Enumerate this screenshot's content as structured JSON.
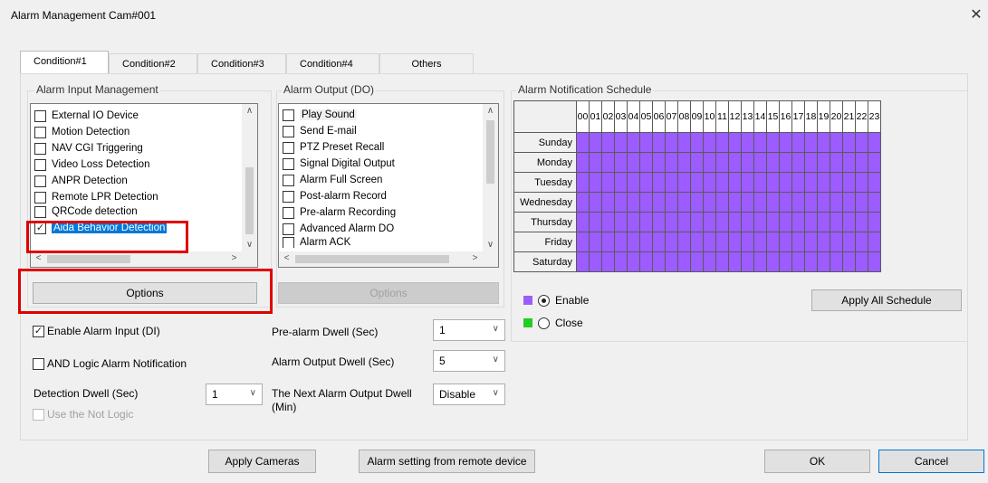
{
  "window": {
    "title": "Alarm Management Cam#001",
    "close_glyph": "✕"
  },
  "tabs": [
    "Condition#1",
    "Condition#2",
    "Condition#3",
    "Condition#4",
    "Others"
  ],
  "input_group": {
    "label": "Alarm Input Management",
    "items": [
      {
        "label": "External IO Device",
        "checked": false
      },
      {
        "label": "Motion Detection",
        "checked": false
      },
      {
        "label": "NAV CGI Triggering",
        "checked": false
      },
      {
        "label": "Video Loss Detection",
        "checked": false
      },
      {
        "label": "ANPR Detection",
        "checked": false
      },
      {
        "label": "Remote LPR Detection",
        "checked": false
      },
      {
        "label": "QRCode detection",
        "checked": false
      },
      {
        "label": "Aida Behavior Detection",
        "checked": true
      }
    ],
    "options_label": "Options"
  },
  "output_group": {
    "label": "Alarm Output (DO)",
    "items": [
      {
        "label": "Play Sound",
        "checked": false
      },
      {
        "label": "Send E-mail",
        "checked": false
      },
      {
        "label": "PTZ Preset Recall",
        "checked": false
      },
      {
        "label": "Signal Digital Output",
        "checked": false
      },
      {
        "label": "Alarm Full Screen",
        "checked": false
      },
      {
        "label": "Post-alarm Record",
        "checked": false
      },
      {
        "label": "Pre-alarm Recording",
        "checked": false
      },
      {
        "label": "Advanced Alarm DO",
        "checked": false
      },
      {
        "label": "Alarm ACK",
        "checked": false
      }
    ],
    "options_label": "Options"
  },
  "settings": {
    "enable_alarm_input": "Enable Alarm Input (DI)",
    "and_logic": "AND Logic Alarm Notification",
    "detection_dwell_label": "Detection Dwell (Sec)",
    "detection_dwell_value": "1",
    "use_not_logic": "Use the Not Logic",
    "pre_alarm_label": "Pre-alarm Dwell (Sec)",
    "pre_alarm_value": "1",
    "output_dwell_label": "Alarm Output Dwell (Sec)",
    "output_dwell_value": "5",
    "next_output_label_1": "The Next Alarm Output Dwell",
    "next_output_label_2": "(Min)",
    "next_output_value": "Disable"
  },
  "schedule": {
    "label": "Alarm Notification Schedule",
    "hours": [
      "00",
      "01",
      "02",
      "03",
      "04",
      "05",
      "06",
      "07",
      "08",
      "09",
      "10",
      "11",
      "12",
      "13",
      "14",
      "15",
      "16",
      "17",
      "18",
      "19",
      "20",
      "21",
      "22",
      "23"
    ],
    "days": [
      "Sunday",
      "Monday",
      "Tuesday",
      "Wednesday",
      "Thursday",
      "Friday",
      "Saturday"
    ],
    "enable_color": "#9c5cff",
    "close_color": "#22cc22",
    "legend_enable": "Enable",
    "legend_close": "Close",
    "apply_all": "Apply All Schedule"
  },
  "footer": {
    "apply_cameras": "Apply Cameras",
    "remote": "Alarm setting from remote device",
    "ok": "OK",
    "cancel": "Cancel"
  }
}
